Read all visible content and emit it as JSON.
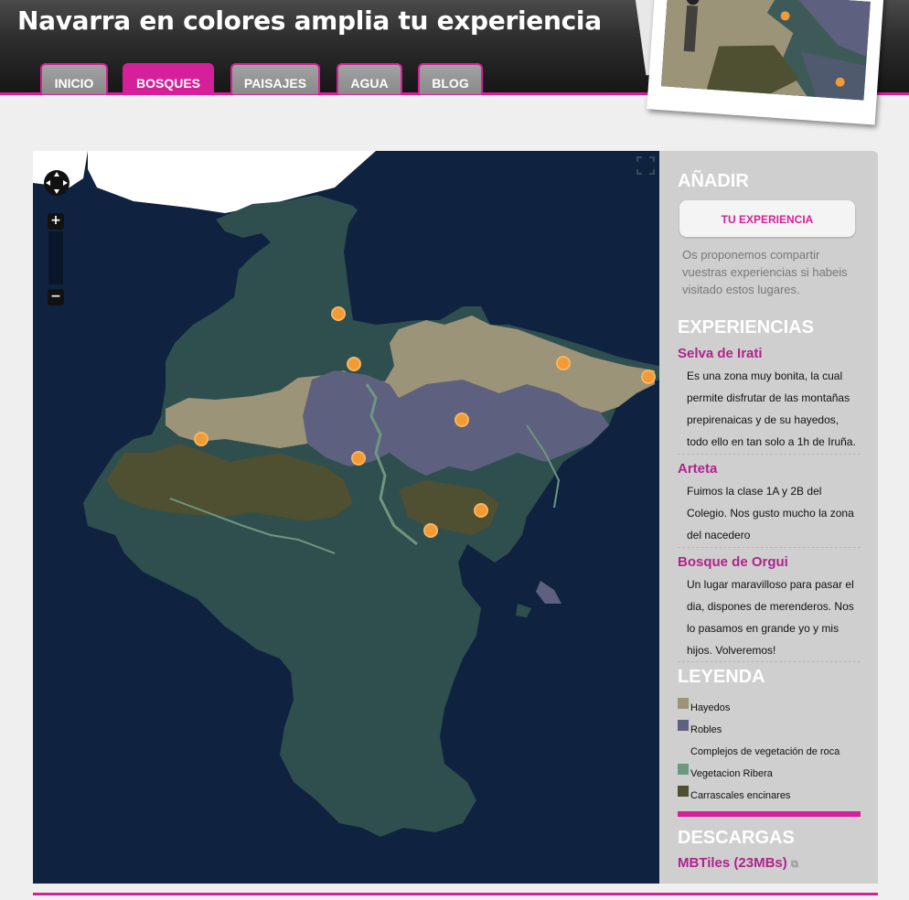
{
  "header": {
    "title": "Navarra en colores amplia tu experiencia",
    "tabs": [
      {
        "label": "INICIO",
        "active": false
      },
      {
        "label": "BOSQUES",
        "active": true
      },
      {
        "label": "PAISAJES",
        "active": false
      },
      {
        "label": "AGUA",
        "active": false
      },
      {
        "label": "BLOG",
        "active": false
      }
    ]
  },
  "map": {
    "zoom_in_label": "+",
    "zoom_out_label": "−",
    "colors": {
      "sea": "#0f2340",
      "land": "#2e4f4e",
      "marker": "#f29a34"
    }
  },
  "sidebar": {
    "add": {
      "title": "AÑADIR",
      "button_label": "TU EXPERIENCIA",
      "description": "Os proponemos compartir vuestras experiencias si habeis visitado estos lugares."
    },
    "experiences": {
      "title": "EXPERIENCIAS",
      "items": [
        {
          "title": "Selva de Irati",
          "lines": [
            "Es una zona muy bonita, la cual",
            "permite disfrutar de las montañas",
            "prepirenaicas y de su hayedos,",
            "todo ello en tan solo a 1h de Iruña."
          ]
        },
        {
          "title": "Arteta",
          "lines": [
            "Fuimos la clase 1A y 2B del",
            "Colegio. Nos gusto mucho la zona",
            "del nacedero"
          ]
        },
        {
          "title": "Bosque de Orgui",
          "lines": [
            "Un lugar maravilloso para pasar el",
            "dia, dispones de merenderos. Nos",
            "lo pasamos en grande yo y mis",
            "hijos. Volveremos!"
          ]
        }
      ]
    },
    "legend": {
      "title": "LEYENDA",
      "items": [
        {
          "label": "Hayedos",
          "color": "#9c9479"
        },
        {
          "label": "Robles",
          "color": "#5d617f"
        },
        {
          "label": "Complejos de vegetación de roca",
          "color": ""
        },
        {
          "label": "Vegetacion Ribera",
          "color": "#6f9680"
        },
        {
          "label": "Carrascales encinares",
          "color": "#4f4f32"
        }
      ]
    },
    "downloads": {
      "title": "DESCARGAS",
      "link_label": "MBTiles (23MBs)"
    }
  }
}
